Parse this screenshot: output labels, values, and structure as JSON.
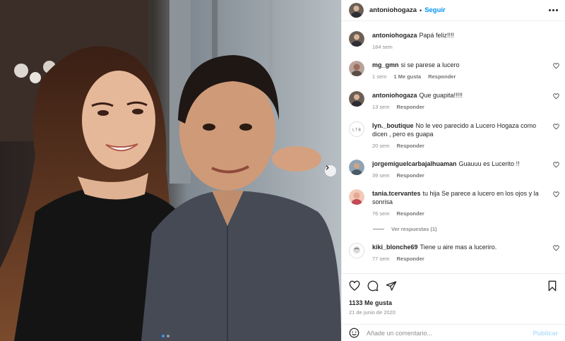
{
  "post": {
    "author": "antoniohogaza",
    "follow_label": "Seguir",
    "separator": "•"
  },
  "caption": {
    "user": "antoniohogaza",
    "text": "Papá feliz!!!!",
    "time": "184 sem"
  },
  "comments": [
    {
      "user": "mg_gmn",
      "text": "si se parese a lucero",
      "time": "1 sem",
      "likes": "1 Me gusta",
      "reply": "Responder"
    },
    {
      "user": "antoniohogaza",
      "text": "Que guapita!!!!!",
      "time": "13 sem",
      "reply": "Responder"
    },
    {
      "user": "lyn._boutique",
      "text": "No le veo parecido a Lucero Hogaza como dicen , pero es guapa",
      "time": "20 sem",
      "reply": "Responder"
    },
    {
      "user": "jorgemiguelcarbajalhuaman",
      "text": "Guauuu es Lucerito !!",
      "time": "39 sem",
      "reply": "Responder"
    },
    {
      "user": "tania.tcervantes",
      "text": "tu hija Se parece a lucero en los ojos y la sonrisa",
      "time": "76 sem",
      "reply": "Responder"
    },
    {
      "user": "kiki_blonche69",
      "text": "Tiene u aire mas a luceriro.",
      "time": "77 sem",
      "reply": "Responder"
    }
  ],
  "view_replies": "Ver respuestas (1)",
  "likes_count": "1133 Me gusta",
  "post_date": "21 de junio de 2020",
  "add_comment": {
    "placeholder": "Añade un comentario...",
    "post_label": "Publicar"
  },
  "carousel": {
    "slides": 2,
    "active": 1
  },
  "colors": {
    "link": "#0095f6",
    "muted": "#8e8e8e",
    "text": "#262626",
    "border": "#efefef"
  },
  "icons": [
    "more-icon",
    "heart-icon",
    "comment-icon",
    "share-icon",
    "bookmark-icon",
    "emoji-icon",
    "chevron-right-icon"
  ]
}
